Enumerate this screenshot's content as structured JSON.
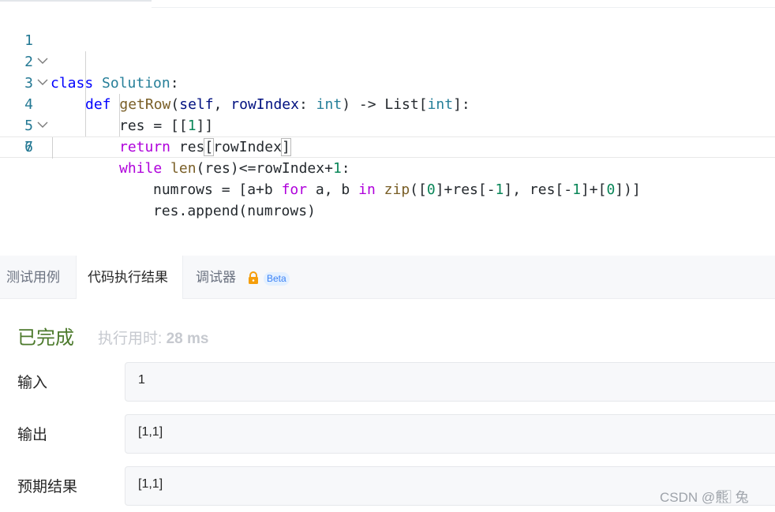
{
  "editor": {
    "lines": [
      {
        "num": "1",
        "tokens": [
          {
            "t": "class",
            "c": "kw"
          },
          {
            "t": " "
          },
          {
            "t": "Solution",
            "c": "cls"
          },
          {
            "t": ":"
          }
        ]
      },
      {
        "num": "2",
        "tokens": [
          {
            "t": "def",
            "c": "kw"
          },
          {
            "t": " "
          },
          {
            "t": "getRow",
            "c": "fn"
          },
          {
            "t": "("
          },
          {
            "t": "self",
            "c": "var"
          },
          {
            "t": ", "
          },
          {
            "t": "rowIndex",
            "c": "var"
          },
          {
            "t": ": "
          },
          {
            "t": "int",
            "c": "cls"
          },
          {
            "t": ") -> List["
          },
          {
            "t": "int",
            "c": "cls"
          },
          {
            "t": "]:"
          }
        ]
      },
      {
        "num": "3",
        "tokens": [
          {
            "t": "res = [["
          },
          {
            "t": "1",
            "c": "num"
          },
          {
            "t": "]]"
          }
        ]
      },
      {
        "num": "4",
        "tokens": [
          {
            "t": "while",
            "c": "kw2"
          },
          {
            "t": " "
          },
          {
            "t": "len",
            "c": "fn"
          },
          {
            "t": "(res)<=rowIndex+"
          },
          {
            "t": "1",
            "c": "num"
          },
          {
            "t": ":"
          }
        ]
      },
      {
        "num": "5",
        "tokens": [
          {
            "t": "numrows = [a+b "
          },
          {
            "t": "for",
            "c": "kw2"
          },
          {
            "t": " a, b "
          },
          {
            "t": "in",
            "c": "kw2"
          },
          {
            "t": " "
          },
          {
            "t": "zip",
            "c": "fn"
          },
          {
            "t": "(["
          },
          {
            "t": "0",
            "c": "num"
          },
          {
            "t": "]+res[-"
          },
          {
            "t": "1",
            "c": "num"
          },
          {
            "t": "], res[-"
          },
          {
            "t": "1",
            "c": "num"
          },
          {
            "t": "]+["
          },
          {
            "t": "0",
            "c": "num"
          },
          {
            "t": "])]"
          }
        ]
      },
      {
        "num": "6",
        "tokens": [
          {
            "t": "res.append(numrows)"
          }
        ]
      },
      {
        "num": "7",
        "tokens": [
          {
            "t": "return",
            "c": "kw2"
          },
          {
            "t": " res"
          },
          {
            "t": "[",
            "c": "br"
          },
          {
            "t": "rowIndex"
          },
          {
            "t": "]",
            "c": "br"
          }
        ]
      }
    ]
  },
  "tabs": {
    "test_cases": "测试用例",
    "run_result": "代码执行结果",
    "debugger": "调试器",
    "beta": "Beta"
  },
  "result": {
    "status": "已完成",
    "runtime_label": "执行用时:",
    "runtime_value": "28 ms",
    "input_label": "输入",
    "input_value": "1",
    "output_label": "输出",
    "output_value": "[1,1]",
    "expected_label": "预期结果",
    "expected_value": "[1,1]"
  },
  "watermark": "CSDN @熊 ⃞ 兔",
  "colors": {
    "status_green": "#4c7a2c",
    "beta_blue": "#3b82f6",
    "lock_orange": "#f59e0b"
  },
  "icons": {
    "fold": "chevron-down-icon",
    "debugger_lock": "lock-icon"
  }
}
